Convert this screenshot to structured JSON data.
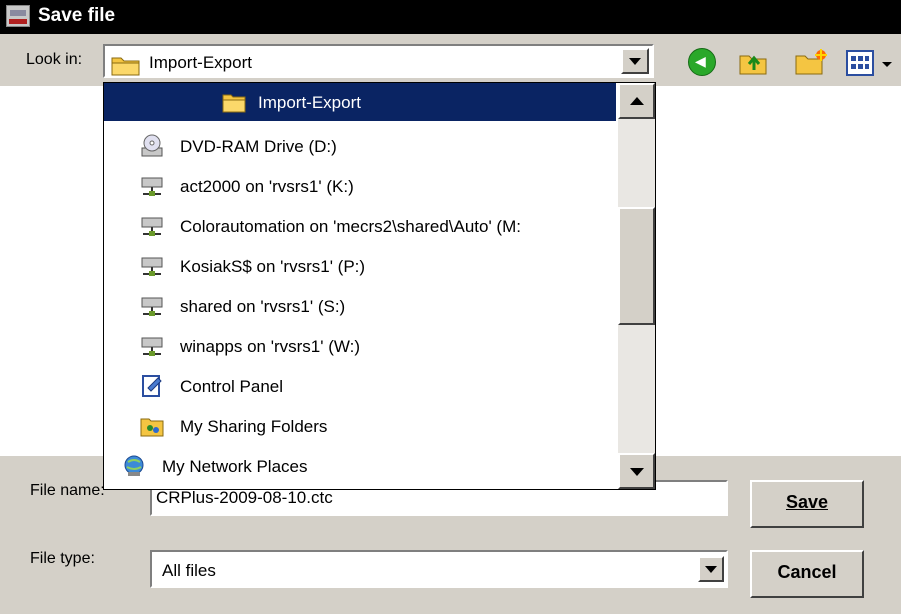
{
  "window": {
    "title": "Save file"
  },
  "toolbar": {
    "look_in_label": "Look in:",
    "look_in_value": "Import-Export",
    "icons": [
      "back-icon",
      "up-folder-icon",
      "new-folder-icon",
      "views-menu-icon"
    ]
  },
  "dropdown": {
    "items": [
      {
        "label": "Import-Export",
        "icon": "folder-icon",
        "selected": true
      },
      {
        "label": "DVD-RAM Drive (D:)",
        "icon": "dvd-drive-icon"
      },
      {
        "label": "act2000 on 'rvsrs1' (K:)",
        "icon": "network-drive-icon"
      },
      {
        "label": "Colorautomation on 'mecrs2\\shared\\Auto' (M:",
        "icon": "network-drive-icon"
      },
      {
        "label": "KosiakS$ on 'rvsrs1' (P:)",
        "icon": "network-drive-icon"
      },
      {
        "label": "shared on 'rvsrs1' (S:)",
        "icon": "network-drive-icon"
      },
      {
        "label": "winapps on 'rvsrs1' (W:)",
        "icon": "network-drive-icon"
      },
      {
        "label": "Control Panel",
        "icon": "control-panel-icon"
      },
      {
        "label": "My Sharing Folders",
        "icon": "sharing-folders-icon"
      },
      {
        "label": "My Network Places",
        "icon": "network-places-icon"
      }
    ]
  },
  "form": {
    "file_name_label": "File name:",
    "file_name_value": "CRPlus-2009-08-10.ctc",
    "file_type_label": "File type:",
    "file_type_value": "All files"
  },
  "buttons": {
    "save": "Save",
    "cancel": "Cancel"
  },
  "colors": {
    "selection": "#0a2463",
    "titlebar": "#000000",
    "face": "#d4d0c8"
  }
}
